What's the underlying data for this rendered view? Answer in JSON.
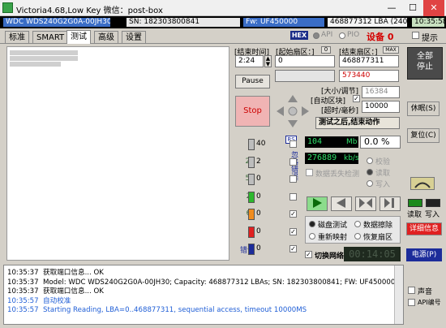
{
  "window": {
    "title": "Victoria4.68,Low Key 微信：post-box",
    "min": "—",
    "max": "☐",
    "close": "✕"
  },
  "infobar": {
    "model": "WDC WDS240G2G0A-00JH30",
    "sn": "SN: 182303800841",
    "fw": "Fw: UF450000",
    "capacity": "468877312 LBA (240 Gb)",
    "time": "10:35:58"
  },
  "tabs": [
    "标准",
    "SMART",
    "测试",
    "高级",
    "设置"
  ],
  "active_tab": "测试",
  "topright": {
    "hex": "HEX",
    "api": "API",
    "pio": "PIO",
    "device": "设备 0",
    "hint": "提示"
  },
  "controls": {
    "end_time_label": "[结束时间]",
    "end_time_value": "2:24",
    "start_lba_label": "[起始扇区：]",
    "start_lba_value": "0",
    "end_lba_label": "[结束扇区：]",
    "end_lba_tag": "MAX",
    "end_lba_value": "468877311",
    "cur_value": "573440",
    "pause_label": "Pause",
    "stop_label": "Stop",
    "size_label": "[大小/调节]",
    "block_label": "[自动区块]",
    "block_value": "16384",
    "timeout_label": "[超时/毫秒]",
    "timeout_value": "10000",
    "after_action": "测试之后,结束动作",
    "rs_label": "RS",
    "ignore_label": "忽略错误"
  },
  "stats": [
    {
      "label": "5",
      "count": "40",
      "color": "#bdbdbd",
      "checked": false
    },
    {
      "label": "20",
      "count": "2",
      "color": "#bdbdbd",
      "checked": false
    },
    {
      "label": "50",
      "count": "0",
      "color": "#bdbdbd",
      "checked": false
    },
    {
      "label": "2s",
      "count": "0",
      "color": "#2db82d",
      "checked": false
    },
    {
      "label": "6s",
      "count": "0",
      "color": "#f08c1e",
      "checked": true
    },
    {
      "label": ">",
      "count": "0",
      "color": "#e02020",
      "checked": true
    },
    {
      "label": "错误",
      "count": "0",
      "color": "#1c2c9a",
      "checked": true
    }
  ],
  "speed": {
    "mb_value": "104",
    "mb_unit": "Mb",
    "pct": "0.0",
    "pct_unit": "%",
    "kbs_value": "276889",
    "kbs_unit": "kb/s",
    "verify": "校验",
    "read": "读取",
    "write": "写入",
    "data_loss": "数据丢失检测"
  },
  "mode_options": [
    "磁盘测试",
    "数据擦除",
    "重新映射",
    "恢复扇区"
  ],
  "net_label": "切换网络",
  "elapsed": "00:14:05",
  "right_buttons": {
    "break": "全部停止",
    "sleep": "休眠(S)",
    "reset": "复位(C)",
    "read": "读取",
    "write": "写入",
    "details": "详细信息",
    "power": "电源(P)",
    "sound": "声音",
    "api_num": "API编号"
  },
  "log": [
    {
      "time": "10:35:37",
      "text": "获取端口信息... OK",
      "color": "#000000"
    },
    {
      "time": "10:35:37",
      "text": "Model: WDC WDS240G2G0A-00JH30; Capacity: 468877312 LBAs; SN: 182303800841; FW: UF450000",
      "color": "#000000"
    },
    {
      "time": "10:35:37",
      "text": "获取端口信息... OK",
      "color": "#000000"
    },
    {
      "time": "10:35:57",
      "text": "自动校准",
      "color": "#1f5ed6"
    },
    {
      "time": "10:35:57",
      "text": "Starting Reading, LBA=0..468877311, sequential access, timeout 10000MS",
      "color": "#1f5ed6"
    }
  ]
}
